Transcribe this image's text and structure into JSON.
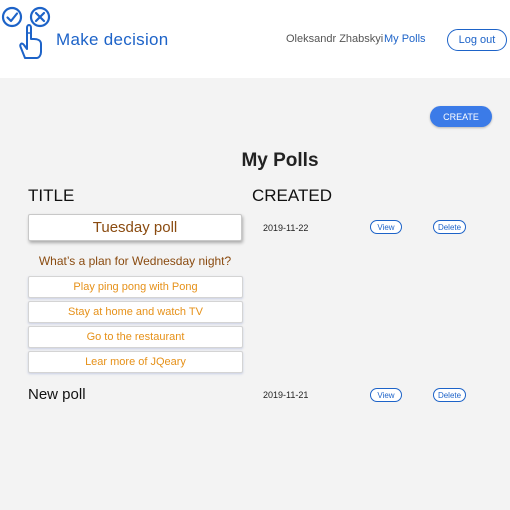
{
  "header": {
    "brand": "Make decision",
    "user_name": "Oleksandr Zhabskyi",
    "nav_my_polls": "My Polls",
    "logout_label": "Log out",
    "accent_color": "#1d63c8"
  },
  "toolbar": {
    "create_label": "CREATE"
  },
  "page": {
    "title": "My Polls",
    "columns": [
      "TITLE",
      "CREATED"
    ]
  },
  "polls": [
    {
      "title": "Tuesday poll",
      "created": "2019-11-22",
      "view_label": "View",
      "delete_label": "Delete",
      "question": "What’s a plan for Wednesday night?",
      "options": [
        "Play ping pong with Pong",
        "Stay at home and watch TV",
        "Go to the restaurant",
        "Lear more of JQeary"
      ]
    },
    {
      "title": "New poll",
      "created": "2019-11-21",
      "view_label": "View",
      "delete_label": "Delete"
    }
  ]
}
